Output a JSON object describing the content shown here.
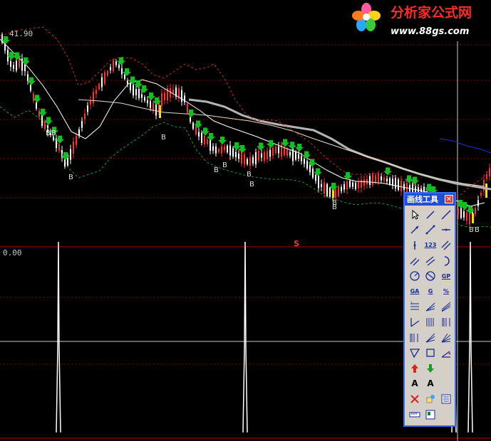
{
  "chart_data": {
    "type": "line",
    "title": "",
    "price_top_label": "41.90",
    "indicator_label": "0.00",
    "signal_marker": "S",
    "buy_marker_label": "B",
    "series": [
      {
        "role": "price",
        "points": [
          [
            0,
            45
          ],
          [
            5,
            60
          ],
          [
            10,
            75
          ],
          [
            15,
            90
          ],
          [
            20,
            95
          ],
          [
            28,
            88
          ],
          [
            35,
            95
          ],
          [
            42,
            120
          ],
          [
            48,
            140
          ],
          [
            55,
            160
          ],
          [
            62,
            175
          ],
          [
            70,
            185
          ],
          [
            78,
            200
          ],
          [
            85,
            210
          ],
          [
            92,
            232
          ],
          [
            100,
            215
          ],
          [
            108,
            195
          ],
          [
            116,
            172
          ],
          [
            124,
            150
          ],
          [
            132,
            135
          ],
          [
            140,
            120
          ],
          [
            148,
            108
          ],
          [
            156,
            95
          ],
          [
            164,
            88
          ],
          [
            172,
            102
          ],
          [
            180,
            118
          ],
          [
            188,
            128
          ],
          [
            196,
            132
          ],
          [
            204,
            140
          ],
          [
            212,
            148
          ],
          [
            220,
            155
          ],
          [
            228,
            138
          ],
          [
            236,
            132
          ],
          [
            244,
            128
          ],
          [
            252,
            132
          ],
          [
            260,
            140
          ],
          [
            268,
            172
          ],
          [
            276,
            185
          ],
          [
            284,
            195
          ],
          [
            292,
            200
          ],
          [
            300,
            210
          ],
          [
            308,
            212
          ],
          [
            316,
            208
          ],
          [
            324,
            212
          ],
          [
            332,
            218
          ],
          [
            340,
            222
          ],
          [
            348,
            228
          ],
          [
            356,
            225
          ],
          [
            364,
            218
          ],
          [
            372,
            220
          ],
          [
            380,
            215
          ],
          [
            388,
            210
          ],
          [
            396,
            212
          ],
          [
            404,
            215
          ],
          [
            412,
            218
          ],
          [
            420,
            220
          ],
          [
            428,
            228
          ],
          [
            436,
            238
          ],
          [
            444,
            252
          ],
          [
            452,
            262
          ],
          [
            460,
            268
          ],
          [
            468,
            275
          ],
          [
            476,
            268
          ],
          [
            484,
            262
          ],
          [
            492,
            258
          ],
          [
            500,
            262
          ],
          [
            508,
            258
          ],
          [
            516,
            255
          ],
          [
            524,
            252
          ],
          [
            532,
            250
          ],
          [
            540,
            252
          ],
          [
            548,
            255
          ],
          [
            556,
            258
          ],
          [
            564,
            262
          ],
          [
            572,
            264
          ],
          [
            580,
            266
          ],
          [
            588,
            268
          ],
          [
            596,
            272
          ],
          [
            604,
            278
          ],
          [
            612,
            282
          ],
          [
            620,
            285
          ],
          [
            628,
            290
          ],
          [
            636,
            295
          ],
          [
            644,
            298
          ],
          [
            652,
            302
          ],
          [
            660,
            308
          ],
          [
            668,
            295
          ],
          [
            676,
            270
          ],
          [
            684,
            245
          ],
          [
            689,
            240
          ]
        ]
      },
      {
        "role": "ma_white",
        "points": [
          [
            0,
            55
          ],
          [
            20,
            75
          ],
          [
            40,
            95
          ],
          [
            60,
            120
          ],
          [
            80,
            150
          ],
          [
            100,
            185
          ],
          [
            120,
            195
          ],
          [
            140,
            178
          ],
          [
            160,
            142
          ],
          [
            180,
            118
          ],
          [
            200,
            112
          ],
          [
            220,
            118
          ],
          [
            240,
            130
          ],
          [
            260,
            142
          ],
          [
            280,
            155
          ],
          [
            300,
            170
          ],
          [
            320,
            178
          ],
          [
            340,
            185
          ],
          [
            360,
            192
          ],
          [
            380,
            200
          ],
          [
            400,
            208
          ],
          [
            420,
            215
          ],
          [
            440,
            228
          ],
          [
            460,
            240
          ],
          [
            480,
            250
          ],
          [
            500,
            255
          ],
          [
            520,
            256
          ],
          [
            540,
            258
          ],
          [
            560,
            262
          ],
          [
            580,
            266
          ],
          [
            600,
            270
          ],
          [
            620,
            275
          ],
          [
            640,
            282
          ],
          [
            660,
            290
          ],
          [
            680,
            285
          ]
        ]
      },
      {
        "role": "ma_gray",
        "points": [
          [
            265,
            140
          ],
          [
            290,
            143
          ],
          [
            315,
            150
          ],
          [
            340,
            162
          ],
          [
            365,
            170
          ],
          [
            390,
            175
          ],
          [
            415,
            179
          ],
          [
            440,
            183
          ],
          [
            465,
            195
          ],
          [
            490,
            210
          ],
          [
            515,
            220
          ],
          [
            540,
            228
          ],
          [
            565,
            237
          ],
          [
            590,
            245
          ],
          [
            615,
            252
          ],
          [
            640,
            258
          ],
          [
            665,
            262
          ],
          [
            689,
            266
          ]
        ]
      },
      {
        "role": "ma_beige",
        "points": [
          [
            110,
            140
          ],
          [
            140,
            142
          ],
          [
            170,
            145
          ],
          [
            200,
            152
          ],
          [
            230,
            158
          ],
          [
            260,
            160
          ],
          [
            290,
            162
          ],
          [
            320,
            166
          ],
          [
            350,
            170
          ],
          [
            380,
            176
          ],
          [
            410,
            184
          ],
          [
            440,
            195
          ],
          [
            470,
            205
          ],
          [
            500,
            215
          ],
          [
            530,
            225
          ],
          [
            560,
            235
          ],
          [
            590,
            245
          ],
          [
            620,
            252
          ],
          [
            650,
            258
          ],
          [
            680,
            262
          ]
        ]
      },
      {
        "role": "boll_upper",
        "points": [
          [
            0,
            50
          ],
          [
            30,
            42
          ],
          [
            60,
            38
          ],
          [
            80,
            55
          ],
          [
            95,
            80
          ],
          [
            110,
            120
          ],
          [
            125,
            115
          ],
          [
            140,
            100
          ],
          [
            155,
            85
          ],
          [
            170,
            80
          ],
          [
            185,
            82
          ],
          [
            200,
            90
          ],
          [
            215,
            105
          ],
          [
            230,
            110
          ],
          [
            245,
            100
          ],
          [
            260,
            90
          ],
          [
            275,
            98
          ],
          [
            290,
            95
          ],
          [
            300,
            90
          ],
          [
            315,
            110
          ],
          [
            330,
            140
          ],
          [
            345,
            160
          ],
          [
            360,
            170
          ],
          [
            375,
            168
          ],
          [
            390,
            170
          ],
          [
            405,
            180
          ],
          [
            420,
            190
          ],
          [
            435,
            200
          ],
          [
            450,
            215
          ],
          [
            465,
            228
          ],
          [
            480,
            240
          ],
          [
            495,
            245
          ],
          [
            510,
            245
          ],
          [
            525,
            244
          ],
          [
            540,
            243
          ],
          [
            555,
            248
          ],
          [
            570,
            255
          ],
          [
            585,
            262
          ],
          [
            600,
            268
          ],
          [
            615,
            275
          ],
          [
            630,
            280
          ],
          [
            645,
            275
          ],
          [
            660,
            262
          ],
          [
            675,
            252
          ],
          [
            689,
            235
          ]
        ]
      },
      {
        "role": "boll_lower",
        "points": [
          [
            0,
            150
          ],
          [
            20,
            165
          ],
          [
            40,
            155
          ],
          [
            60,
            170
          ],
          [
            80,
            200
          ],
          [
            95,
            235
          ],
          [
            110,
            250
          ],
          [
            125,
            245
          ],
          [
            140,
            240
          ],
          [
            155,
            222
          ],
          [
            170,
            210
          ],
          [
            185,
            200
          ],
          [
            200,
            190
          ],
          [
            215,
            178
          ],
          [
            230,
            172
          ],
          [
            245,
            178
          ],
          [
            260,
            180
          ],
          [
            275,
            210
          ],
          [
            290,
            228
          ],
          [
            305,
            235
          ],
          [
            320,
            240
          ],
          [
            335,
            244
          ],
          [
            350,
            248
          ],
          [
            365,
            250
          ],
          [
            380,
            252
          ],
          [
            395,
            252
          ],
          [
            410,
            253
          ],
          [
            425,
            256
          ],
          [
            440,
            265
          ],
          [
            455,
            275
          ],
          [
            470,
            280
          ],
          [
            485,
            285
          ],
          [
            500,
            288
          ],
          [
            515,
            286
          ],
          [
            530,
            285
          ],
          [
            545,
            288
          ],
          [
            560,
            292
          ],
          [
            575,
            296
          ],
          [
            590,
            300
          ],
          [
            605,
            305
          ],
          [
            620,
            310
          ],
          [
            635,
            312
          ],
          [
            650,
            318
          ],
          [
            665,
            320
          ],
          [
            680,
            318
          ],
          [
            689,
            320
          ]
        ]
      },
      {
        "role": "blue_line",
        "points": [
          [
            617,
            195
          ],
          [
            635,
            198
          ],
          [
            655,
            205
          ],
          [
            675,
            210
          ],
          [
            689,
            215
          ]
        ]
      }
    ],
    "indicator_spikes": [
      82,
      344,
      637,
      660
    ]
  },
  "palette": {
    "title": "画线工具",
    "close_glyph": "✕",
    "tools": [
      {
        "icon": "cursor-icon"
      },
      {
        "icon": "line-icon"
      },
      {
        "icon": "ray-icon"
      },
      {
        "icon": "arrow-line-icon"
      },
      {
        "icon": "segment-icon"
      },
      {
        "icon": "horizontal-line-icon"
      },
      {
        "icon": "vertical-line-icon"
      },
      {
        "icon": "price-label-icon",
        "label": "123"
      },
      {
        "icon": "parallel-lines-icon"
      },
      {
        "icon": "dual-lines-icon"
      },
      {
        "icon": "channel-icon"
      },
      {
        "icon": "arc-icon"
      },
      {
        "icon": "circle-icon"
      },
      {
        "icon": "ellipse-icon"
      },
      {
        "icon": "gp-icon",
        "label": "GP"
      },
      {
        "icon": "ga-icon",
        "label": "GA"
      },
      {
        "icon": "gann-icon",
        "label": "G"
      },
      {
        "icon": "percent-icon",
        "label": "%"
      },
      {
        "icon": "fibonacci-icon"
      },
      {
        "icon": "speed-lines-icon"
      },
      {
        "icon": "trend-channel-icon"
      },
      {
        "icon": "regression-icon"
      },
      {
        "icon": "cycle-lines-icon"
      },
      {
        "icon": "time-zones-icon"
      },
      {
        "icon": "fib-time-icon"
      },
      {
        "icon": "fan-lines-icon"
      },
      {
        "icon": "gann-fan-icon"
      },
      {
        "icon": "triangle-icon"
      },
      {
        "icon": "rectangle-icon"
      },
      {
        "icon": "angle-icon"
      },
      {
        "icon": "up-arrow-icon"
      },
      {
        "icon": "down-arrow-icon"
      },
      {
        "icon": "blank-icon"
      },
      {
        "icon": "text-icon",
        "label": "A"
      },
      {
        "icon": "text-box-icon",
        "label": "A"
      },
      {
        "icon": "blank-icon"
      },
      {
        "icon": "delete-icon"
      },
      {
        "icon": "select-icon"
      },
      {
        "icon": "list-icon"
      },
      {
        "icon": "ruler-icon"
      },
      {
        "icon": "save-icon"
      },
      {
        "icon": "blank-icon"
      }
    ]
  },
  "colors": {
    "background": "#000000",
    "grid_red": "#8b0000",
    "up_candle": "#ff3030",
    "down_candle": "#ffffff",
    "buy_arrow": "#10c020",
    "ma_white": "#ffffff",
    "ma_gray": "#b4b4b4",
    "boll_upper": "#c03030",
    "boll_lower": "#20a020",
    "palette_title": "#1f4fd8"
  }
}
